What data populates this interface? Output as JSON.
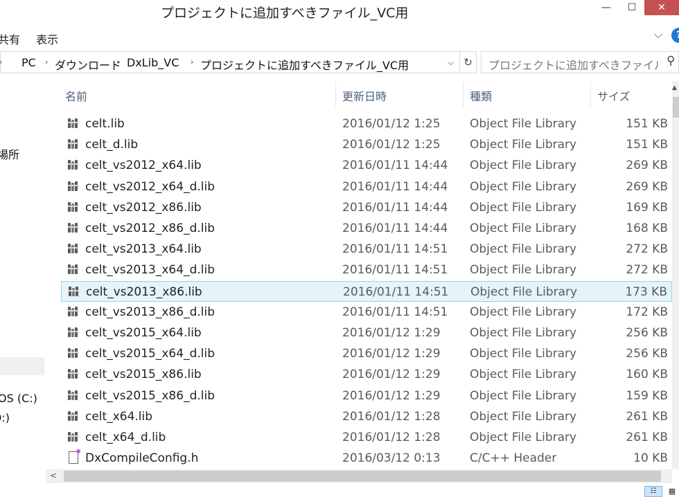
{
  "window": {
    "title": "プロジェクトに追加すべきファイル_VC用",
    "minimize_glyph": "—",
    "maximize_glyph": "☐",
    "close_glyph": "✕"
  },
  "menu": {
    "share": "共有",
    "view": "表示",
    "ribbon_toggle_glyph": "⌵",
    "help_glyph": "?"
  },
  "address": {
    "crumbs": [
      "PC",
      "ダウンロード",
      "DxLib_VC",
      "プロジェクトに追加すべきファイル_VC用"
    ],
    "separator": "›",
    "dropdown_glyph": "⌵",
    "refresh_glyph": "↻"
  },
  "search": {
    "placeholder": "プロジェクトに追加すべきファイル_...",
    "icon": "search-icon",
    "icon_glyph": "⚲"
  },
  "nav": {
    "partial_labels": [
      "場所",
      "OS (C:)",
      "D:)"
    ]
  },
  "columns": {
    "name": "名前",
    "date": "更新日時",
    "type": "種類",
    "size": "サイズ",
    "sort_glyph": "^"
  },
  "files": [
    {
      "name": "celt.lib",
      "date": "2016/01/12 1:25",
      "type": "Object File Library",
      "size": "151 KB",
      "icon": "library-icon"
    },
    {
      "name": "celt_d.lib",
      "date": "2016/01/12 1:25",
      "type": "Object File Library",
      "size": "151 KB",
      "icon": "library-icon"
    },
    {
      "name": "celt_vs2012_x64.lib",
      "date": "2016/01/11 14:44",
      "type": "Object File Library",
      "size": "269 KB",
      "icon": "library-icon"
    },
    {
      "name": "celt_vs2012_x64_d.lib",
      "date": "2016/01/11 14:44",
      "type": "Object File Library",
      "size": "269 KB",
      "icon": "library-icon"
    },
    {
      "name": "celt_vs2012_x86.lib",
      "date": "2016/01/11 14:44",
      "type": "Object File Library",
      "size": "169 KB",
      "icon": "library-icon"
    },
    {
      "name": "celt_vs2012_x86_d.lib",
      "date": "2016/01/11 14:44",
      "type": "Object File Library",
      "size": "168 KB",
      "icon": "library-icon"
    },
    {
      "name": "celt_vs2013_x64.lib",
      "date": "2016/01/11 14:51",
      "type": "Object File Library",
      "size": "272 KB",
      "icon": "library-icon"
    },
    {
      "name": "celt_vs2013_x64_d.lib",
      "date": "2016/01/11 14:51",
      "type": "Object File Library",
      "size": "272 KB",
      "icon": "library-icon"
    },
    {
      "name": "celt_vs2013_x86.lib",
      "date": "2016/01/11 14:51",
      "type": "Object File Library",
      "size": "173 KB",
      "icon": "library-icon",
      "selected": true
    },
    {
      "name": "celt_vs2013_x86_d.lib",
      "date": "2016/01/11 14:51",
      "type": "Object File Library",
      "size": "172 KB",
      "icon": "library-icon"
    },
    {
      "name": "celt_vs2015_x64.lib",
      "date": "2016/01/12 1:29",
      "type": "Object File Library",
      "size": "256 KB",
      "icon": "library-icon"
    },
    {
      "name": "celt_vs2015_x64_d.lib",
      "date": "2016/01/12 1:29",
      "type": "Object File Library",
      "size": "256 KB",
      "icon": "library-icon"
    },
    {
      "name": "celt_vs2015_x86.lib",
      "date": "2016/01/12 1:29",
      "type": "Object File Library",
      "size": "160 KB",
      "icon": "library-icon"
    },
    {
      "name": "celt_vs2015_x86_d.lib",
      "date": "2016/01/12 1:29",
      "type": "Object File Library",
      "size": "159 KB",
      "icon": "library-icon"
    },
    {
      "name": "celt_x64.lib",
      "date": "2016/01/12 1:28",
      "type": "Object File Library",
      "size": "261 KB",
      "icon": "library-icon"
    },
    {
      "name": "celt_x64_d.lib",
      "date": "2016/01/12 1:28",
      "type": "Object File Library",
      "size": "261 KB",
      "icon": "library-icon"
    },
    {
      "name": "DxCompileConfig.h",
      "date": "2016/03/12 0:13",
      "type": "C/C++ Header",
      "size": "10 KB",
      "icon": "header-file-icon"
    }
  ],
  "scroll": {
    "left_glyph": "<",
    "up_glyph": "▲"
  },
  "status": {
    "details_view_glyph": "☷",
    "tiles_view_glyph": "▦"
  },
  "colors": {
    "selection_bg": "#e5f3fb",
    "selection_border": "#99d1ef",
    "header_text": "#4c607a",
    "close_button": "#c75050"
  }
}
